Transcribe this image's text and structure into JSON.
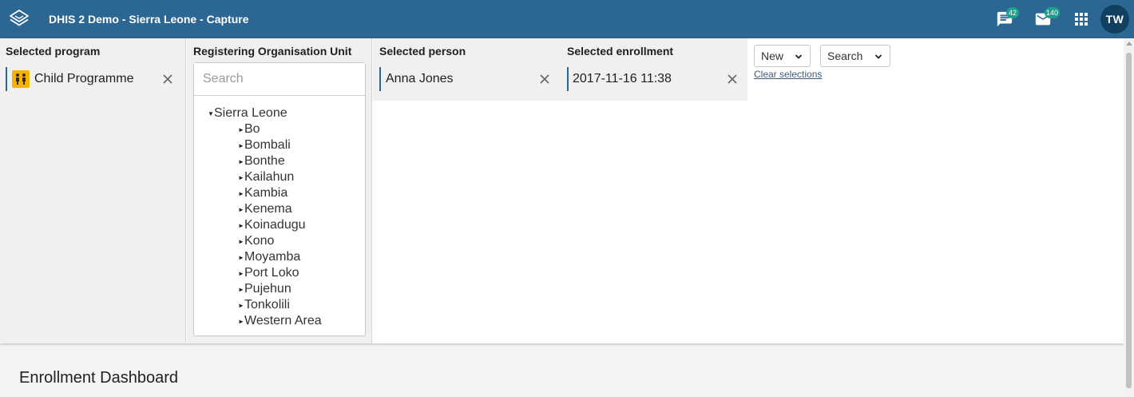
{
  "header": {
    "title": "DHIS 2 Demo - Sierra Leone - Capture",
    "messages_badge": "42",
    "interpretations_badge": "140",
    "avatar_initials": "TW",
    "bar_color": "#2c6693"
  },
  "program": {
    "label": "Selected program",
    "value": "Child Programme",
    "icon": "children-icon"
  },
  "orgunit": {
    "label": "Registering Organisation Unit",
    "search_placeholder": "Search",
    "root": "Sierra Leone",
    "children": [
      "Bo",
      "Bombali",
      "Bonthe",
      "Kailahun",
      "Kambia",
      "Kenema",
      "Koinadugu",
      "Kono",
      "Moyamba",
      "Port Loko",
      "Pujehun",
      "Tonkolili",
      "Western Area"
    ]
  },
  "person": {
    "label": "Selected person",
    "value": "Anna Jones"
  },
  "enrollment": {
    "label": "Selected enrollment",
    "value": "2017-11-16 11:38"
  },
  "actions": {
    "new_label": "New",
    "search_label": "Search",
    "clear_label": "Clear selections"
  },
  "dashboard": {
    "title": "Enrollment Dashboard"
  }
}
